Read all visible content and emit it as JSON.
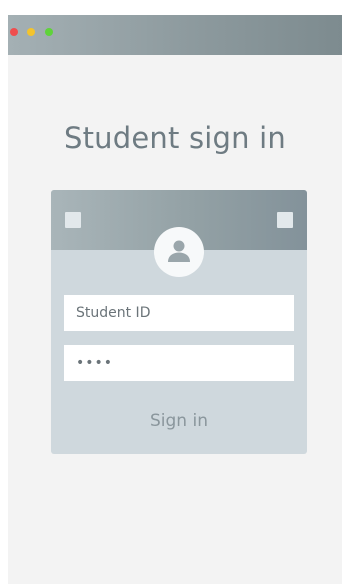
{
  "window": {
    "controls": [
      "close",
      "minimize",
      "maximize"
    ]
  },
  "page": {
    "title": "Student sign in"
  },
  "card": {
    "avatar_icon": "user-icon",
    "student_id_placeholder": "Student ID",
    "password_value": "••••",
    "signin_label": "Sign in"
  },
  "colors": {
    "close": "#f04e4e",
    "minimize": "#f3c42d",
    "maximize": "#5fd33a",
    "title_text": "#6e7b82",
    "card_bg": "#cfd8dd",
    "header_bg": "#93a1a5"
  }
}
